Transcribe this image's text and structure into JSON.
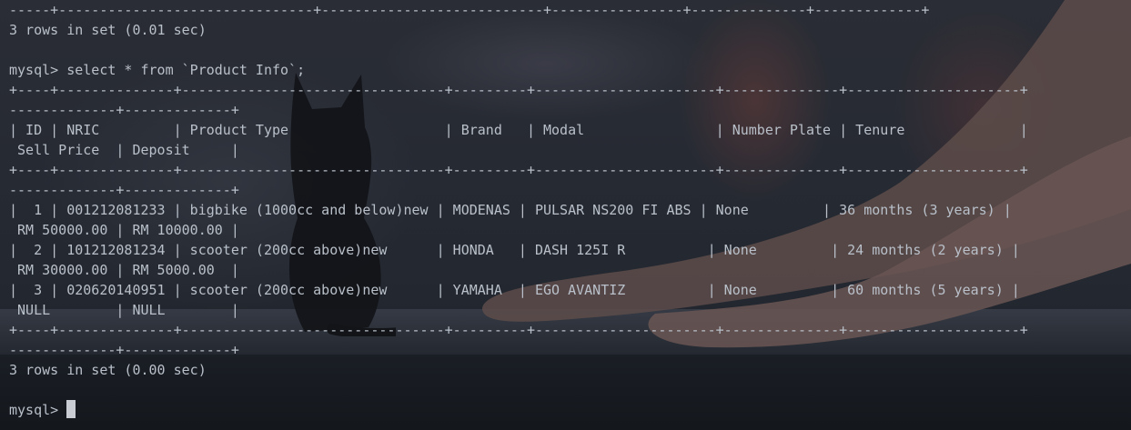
{
  "terminal": {
    "lines": [
      "-----+-------------------------------+---------------------------+----------------+--------------+-------------+",
      "3 rows in set (0.01 sec)",
      "",
      "mysql> select * from `Product Info`;",
      "+----+--------------+--------------------------------+---------+----------------------+--------------+---------------------+",
      "-------------+-------------+",
      "| ID | NRIC         | Product Type                   | Brand   | Modal                | Number Plate | Tenure              |",
      " Sell Price  | Deposit     |",
      "+----+--------------+--------------------------------+---------+----------------------+--------------+---------------------+",
      "-------------+-------------+",
      "|  1 | 001212081233 | bigbike (1000cc and below)new | MODENAS | PULSAR NS200 FI ABS | None         | 36 months (3 years) |",
      " RM 50000.00 | RM 10000.00 |",
      "|  2 | 101212081234 | scooter (200cc above)new      | HONDA   | DASH 125I R          | None         | 24 months (2 years) |",
      " RM 30000.00 | RM 5000.00  |",
      "|  3 | 020620140951 | scooter (200cc above)new      | YAMAHA  | EGO AVANTIZ          | None         | 60 months (5 years) |",
      " NULL        | NULL        |",
      "+----+--------------+--------------------------------+---------+----------------------+--------------+---------------------+",
      "-------------+-------------+",
      "3 rows in set (0.00 sec)",
      ""
    ],
    "prompt": "mysql> ",
    "text_color": "#b9c0c9",
    "background_color": "#1b2027"
  }
}
